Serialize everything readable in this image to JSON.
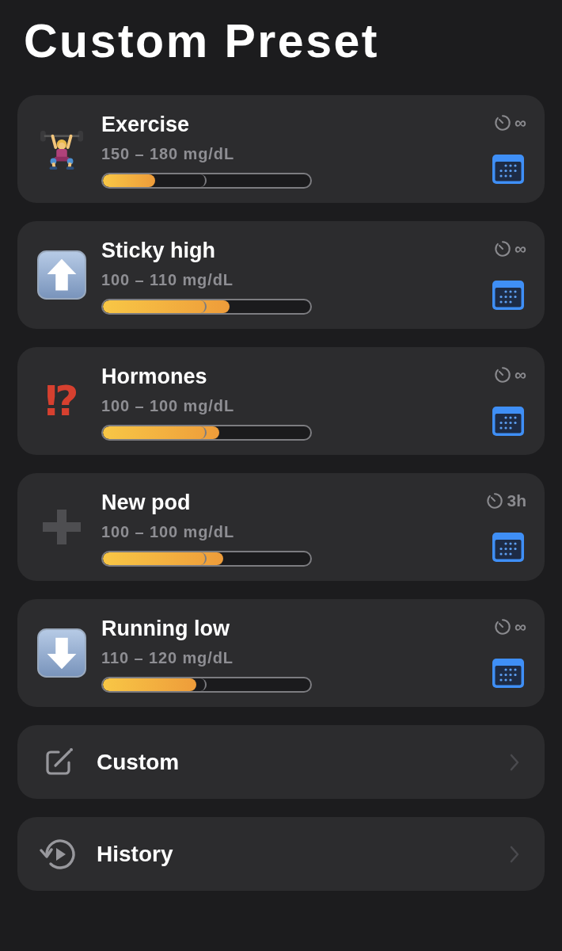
{
  "title": "Custom Preset",
  "presets": [
    {
      "kind": "lifter",
      "name": "Exercise",
      "range": "150 – 180 mg/dL",
      "level": 0.25,
      "duration": "∞"
    },
    {
      "kind": "up",
      "name": "Sticky high",
      "range": "100 – 110 mg/dL",
      "level": 0.61,
      "duration": "∞"
    },
    {
      "kind": "symbol",
      "symbol": "⁉",
      "name": "Hormones",
      "range": "100 – 100 mg/dL",
      "level": 0.56,
      "duration": "∞"
    },
    {
      "kind": "plus",
      "name": "New pod",
      "range": "100 – 100 mg/dL",
      "level": 0.58,
      "duration": "3h"
    },
    {
      "kind": "down",
      "name": "Running low",
      "range": "110 – 120 mg/dL",
      "level": 0.45,
      "duration": "∞"
    }
  ],
  "links": [
    {
      "kind": "edit",
      "label": "Custom"
    },
    {
      "kind": "history",
      "label": "History"
    }
  ]
}
